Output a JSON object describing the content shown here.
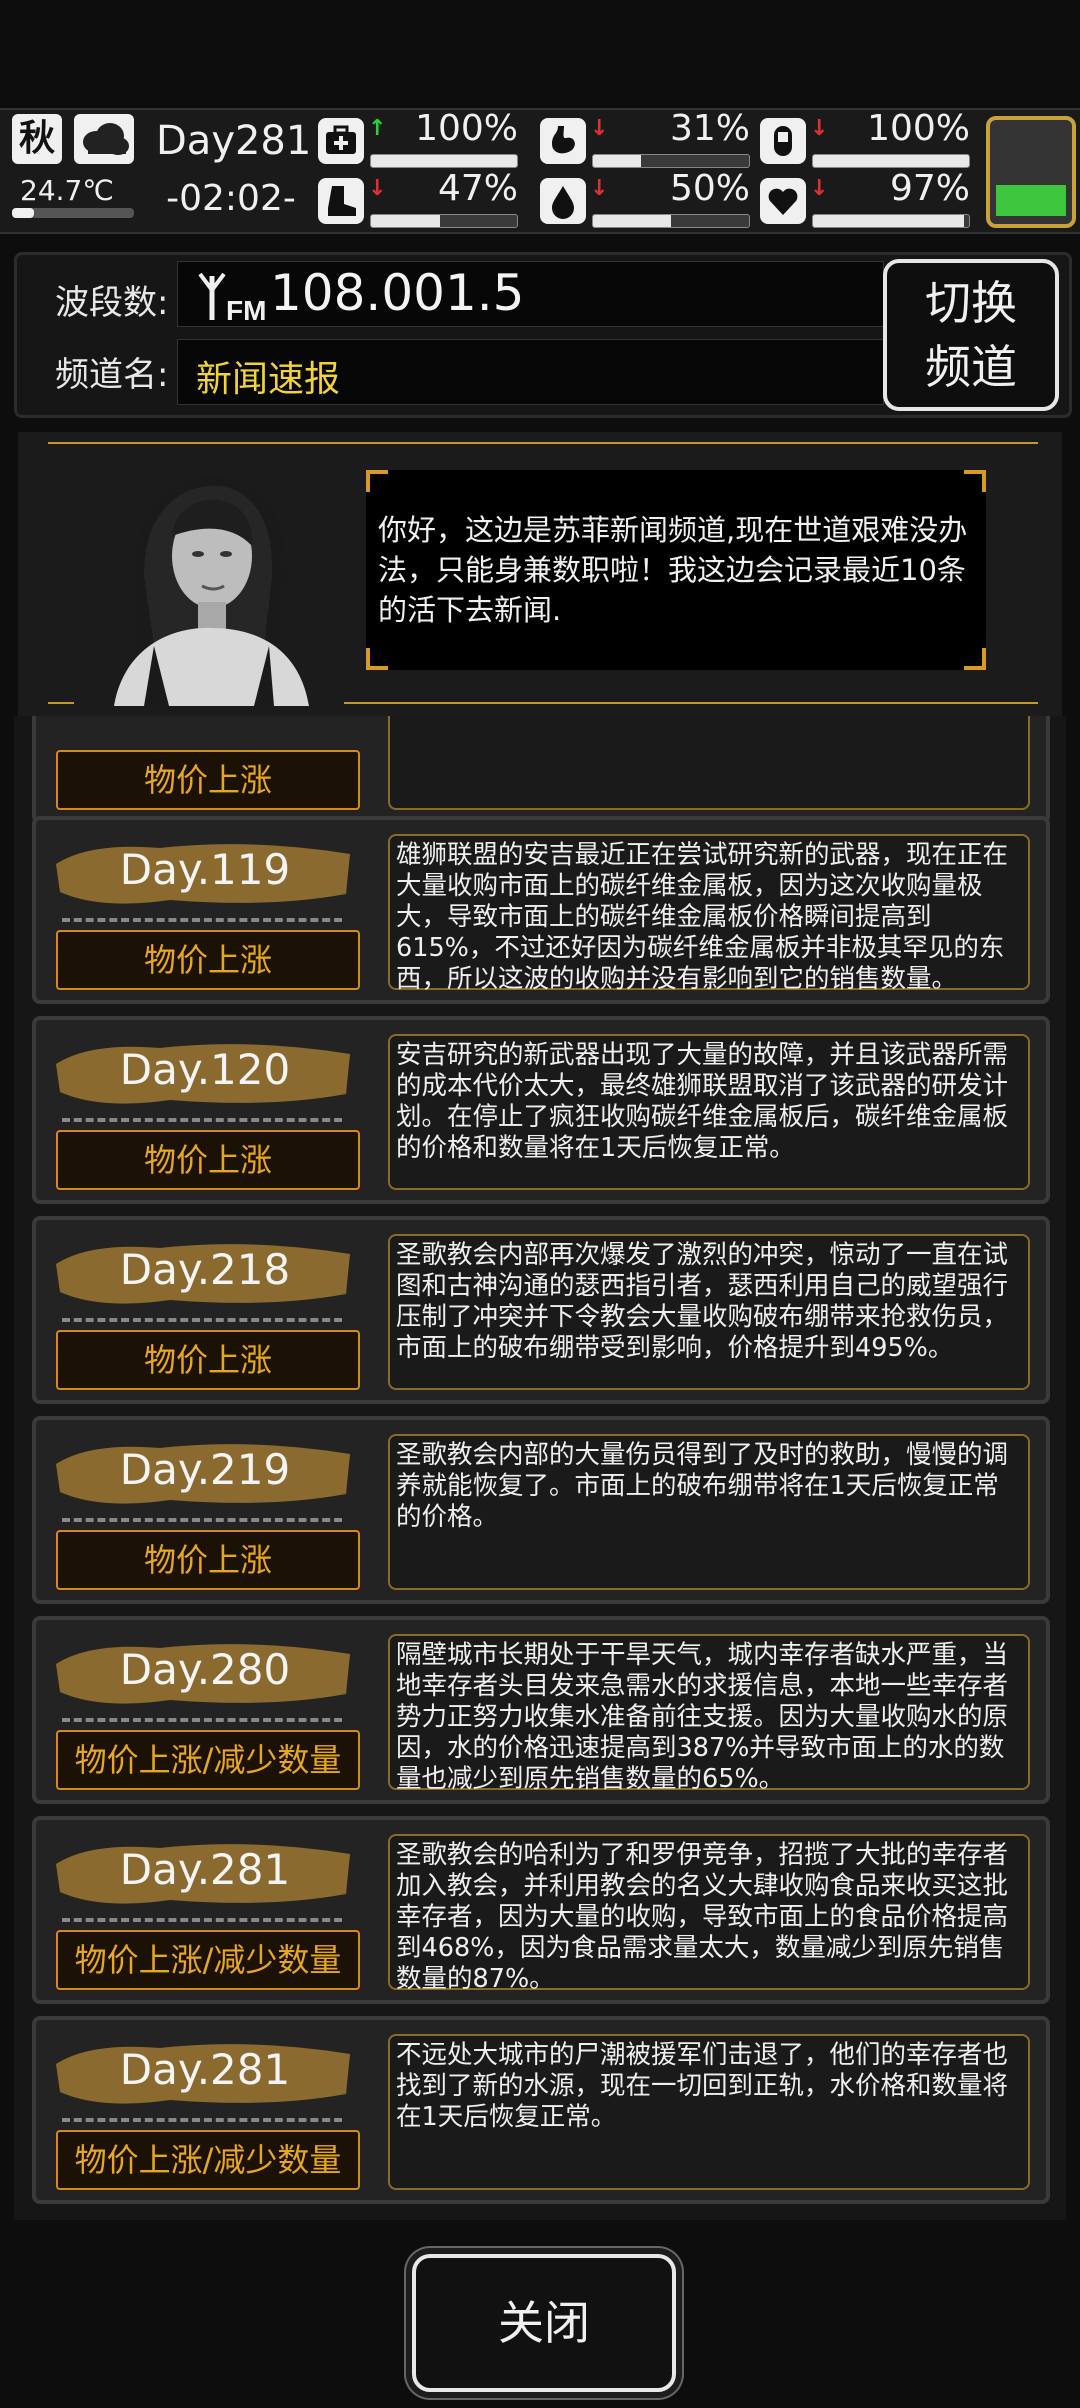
{
  "status": {
    "season": "秋",
    "temperature": "24.7℃",
    "temperature_level": 0.18,
    "day": "Day281",
    "time": "-02:02-",
    "weather_icon": "cloud-icon",
    "stats": [
      {
        "icon": "medkit-icon",
        "trend": "up",
        "value": "100%",
        "level": 1.0
      },
      {
        "icon": "stomach-icon",
        "trend": "down",
        "value": "31%",
        "level": 0.31
      },
      {
        "icon": "pill-icon",
        "trend": "down",
        "value": "100%",
        "level": 1.0
      },
      {
        "icon": "boot-icon",
        "trend": "down",
        "value": "47%",
        "level": 0.47
      },
      {
        "icon": "water-drop-icon",
        "trend": "down",
        "value": "50%",
        "level": 0.5
      },
      {
        "icon": "heart-icon",
        "trend": "down",
        "value": "97%",
        "level": 0.97
      }
    ],
    "battery_level": 0.3,
    "colors": {
      "up": "#29d13a",
      "down": "#e03030",
      "battery": "#3ec53e"
    }
  },
  "radio": {
    "band_label": "波段数:",
    "frequency": "108.001.5",
    "fm_label": "FM",
    "channel_label": "频道名:",
    "channel_name": "新闻速报",
    "switch_line1": "切换",
    "switch_line2": "频道"
  },
  "announcer": {
    "text": "你好，这边是苏菲新闻频道,现在世道艰难没办法，只能身兼数职啦！我这边会记录最近10条的活下去新闻."
  },
  "news": [
    {
      "day": "",
      "tag": "物价上涨",
      "text": ""
    },
    {
      "day": "Day.119",
      "tag": "物价上涨",
      "text": "雄狮联盟的安吉最近正在尝试研究新的武器，现在正在大量收购市面上的碳纤维金属板，因为这次收购量极大，导致市面上的碳纤维金属板价格瞬间提高到615%，不过还好因为碳纤维金属板并非极其罕见的东西，所以这波的收购并没有影响到它的销售数量。"
    },
    {
      "day": "Day.120",
      "tag": "物价上涨",
      "text": "安吉研究的新武器出现了大量的故障，并且该武器所需的成本代价太大，最终雄狮联盟取消了该武器的研发计划。在停止了疯狂收购碳纤维金属板后，碳纤维金属板的价格和数量将在1天后恢复正常。"
    },
    {
      "day": "Day.218",
      "tag": "物价上涨",
      "text": "圣歌教会内部再次爆发了激烈的冲突，惊动了一直在试图和古神沟通的瑟西指引者，瑟西利用自己的威望强行压制了冲突并下令教会大量收购破布绷带来抢救伤员，市面上的破布绷带受到影响，价格提升到495%。"
    },
    {
      "day": "Day.219",
      "tag": "物价上涨",
      "text": "圣歌教会内部的大量伤员得到了及时的救助，慢慢的调养就能恢复了。市面上的破布绷带将在1天后恢复正常的价格。"
    },
    {
      "day": "Day.280",
      "tag": "物价上涨/减少数量",
      "text": "隔壁城市长期处于干旱天气，城内幸存者缺水严重，当地幸存者头目发来急需水的求援信息，本地一些幸存者势力正努力收集水准备前往支援。因为大量收购水的原因，水的价格迅速提高到387%并导致市面上的水的数量也减少到原先销售数量的65%。"
    },
    {
      "day": "Day.281",
      "tag": "物价上涨/减少数量",
      "text": "圣歌教会的哈利为了和罗伊竞争，招揽了大批的幸存者加入教会，并利用教会的名义大肆收购食品来收买这批幸存者，因为大量的收购，导致市面上的食品价格提高到468%，因为食品需求量太大，数量减少到原先销售数量的87%。"
    },
    {
      "day": "Day.281",
      "tag": "物价上涨/减少数量",
      "text": "不远处大城市的尸潮被援军们击退了，他们的幸存者也找到了新的水源，现在一切回到正轨，水价格和数量将在1天后恢复正常。"
    }
  ],
  "close_label": "关闭",
  "colors": {
    "accent": "#d68a1c",
    "tag_text": "#e7a623",
    "channel": "#f1d43a"
  }
}
